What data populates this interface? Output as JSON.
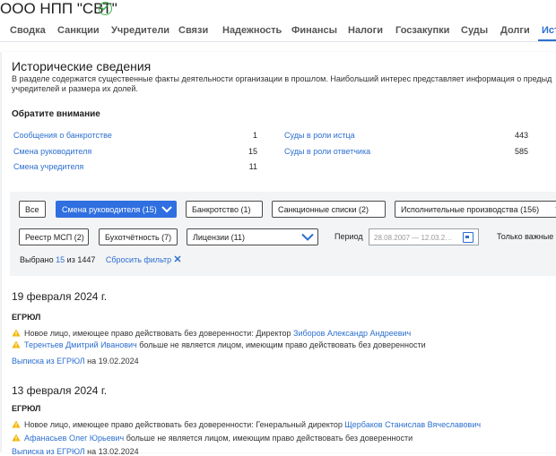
{
  "company": {
    "name": "ООО НПП \"СВТ\""
  },
  "tabs": [
    {
      "label": "Сводка"
    },
    {
      "label": "Санкции"
    },
    {
      "label": "Учредители"
    },
    {
      "label": "Связи"
    },
    {
      "label": "Надежность"
    },
    {
      "label": "Финансы"
    },
    {
      "label": "Налоги"
    },
    {
      "label": "Госзакупки"
    },
    {
      "label": "Суды"
    },
    {
      "label": "Долги"
    },
    {
      "label": "Исто",
      "active": true
    }
  ],
  "section": {
    "title": "Исторические сведения",
    "description": "В разделе содержатся существенные факты деятельности организации в прошлом. Наибольший интерес представляет информация о предыд учредителей и размера их долей."
  },
  "attention": {
    "title": "Обратите внимание",
    "left": [
      {
        "label": "Сообщения о банкротстве",
        "value": "1"
      },
      {
        "label": "Смена руководителя",
        "value": "15"
      },
      {
        "label": "Смена учредителя",
        "value": "11"
      }
    ],
    "right": [
      {
        "label": "Суды в роли истца",
        "value": "443"
      },
      {
        "label": "Суды в роли ответчика",
        "value": "585"
      }
    ]
  },
  "filters": {
    "row1": [
      {
        "label": "Все"
      },
      {
        "label": "Смена руководителя (15)",
        "active": true
      },
      {
        "label": "Банкротство (1)"
      },
      {
        "label": "Санкционные списки (2)"
      },
      {
        "label": "Исполнительные производства (156)"
      }
    ],
    "row2": [
      {
        "label": "Реестр МСП (2)"
      },
      {
        "label": "Бухотчётность (7)"
      },
      {
        "label": "Лицензии (11)"
      }
    ],
    "period_label": "Период",
    "period_value": "28.08.2007 — 12.03.2…",
    "only_important": "Только важные",
    "selected_prefix": "Выбрано",
    "selected_count": "15",
    "selected_suffix": "из 1447",
    "reset": "Сбросить фильтр"
  },
  "events": [
    {
      "date": "19 февраля 2024 г.",
      "source": "ЕГРЮЛ",
      "items": [
        {
          "pre": "Новое лицо, имеющее право действовать без доверенности: Директор ",
          "link": "Зиборов Александр Андреевич",
          "post": ""
        },
        {
          "pre": "",
          "link": "Терентьев Дмитрий Иванович",
          "post": " больше не является лицом, имеющим право действовать без доверенности"
        }
      ],
      "ref_link": "Выписка из ЕГРЮЛ",
      "ref_date": "на 19.02.2024"
    },
    {
      "date": "13 февраля 2024 г.",
      "source": "ЕГРЮЛ",
      "items": [
        {
          "pre": "Новое лицо, имеющее право действовать без доверенности: Генеральный директор ",
          "link": "Щербаков Станислав Вячеславович",
          "post": ""
        },
        {
          "pre": "",
          "link": "Афанасьев Олег Юрьевич",
          "post": " больше не является лицом, имеющим право действовать без доверенности"
        }
      ],
      "ref_link": "Выписка из ЕГРЮЛ",
      "ref_date": "на 13.02.2024"
    }
  ],
  "colors": {
    "accent": "#2c6fcf",
    "active_filter": "#2f6fe0",
    "warning": "#f2b705",
    "verified": "#3bb54a"
  }
}
